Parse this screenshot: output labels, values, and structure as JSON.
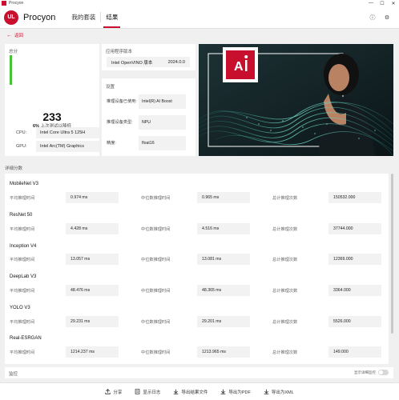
{
  "window": {
    "title": "Procyon",
    "controls": [
      "—",
      "☐",
      "✕"
    ]
  },
  "header": {
    "logo": "UL",
    "brand": "Procyon",
    "nav": [
      {
        "label": "我的套装"
      },
      {
        "label": "结果"
      }
    ],
    "icons": [
      "ⓘ",
      "⚙"
    ]
  },
  "back": {
    "label": "返回"
  },
  "score": {
    "label": "总分",
    "value": "233",
    "delta_value": "6%",
    "delta_text": "上次测试以降低",
    "accent": "#49c239"
  },
  "hardware": {
    "cpu_label": "CPU:",
    "cpu_value": "Intel Core Ultra 5 125H",
    "gpu_label": "GPU:",
    "gpu_value": "Intel Arc(TM) Graphics"
  },
  "version": {
    "label": "应用程序版本",
    "name": "Intel OpenVINO 版本",
    "value": "2024.0.0"
  },
  "settings": {
    "label": "设置",
    "rows": [
      {
        "key": "推理设备已使用:",
        "value": "Intel(R) AI Boost"
      },
      {
        "key": "推理设备类型:",
        "value": "NPU"
      },
      {
        "key": "精度:",
        "value": "float16"
      }
    ]
  },
  "details": {
    "label": "详细分数",
    "col_labels": {
      "avg": "平均推理时间",
      "median": "中位数推理时间",
      "total": "总计推理次数"
    },
    "models": [
      {
        "name": "MobileNet V3",
        "avg": "0.974 ms",
        "median": "0.965 ms",
        "total": "150532.000"
      },
      {
        "name": "ResNet 50",
        "avg": "4.428 ms",
        "median": "4.516 ms",
        "total": "37744.000"
      },
      {
        "name": "Inception V4",
        "avg": "13.057 ms",
        "median": "13.081 ms",
        "total": "12369.000"
      },
      {
        "name": "DeepLab V3",
        "avg": "48.476 ms",
        "median": "48.365 ms",
        "total": "3364.000"
      },
      {
        "name": "YOLO V3",
        "avg": "29.231 ms",
        "median": "29.201 ms",
        "total": "5526.000"
      },
      {
        "name": "Real-ESRGAN",
        "avg": "1214.237 ms",
        "median": "1213.965 ms",
        "total": "149.000"
      }
    ]
  },
  "monitor": {
    "label": "监控",
    "toggle_label": "显示详细监控"
  },
  "footer": {
    "buttons": [
      {
        "label": "分享",
        "icon": "share-icon"
      },
      {
        "label": "显示日志",
        "icon": "log-icon"
      },
      {
        "label": "导出结果文件",
        "icon": "export-file-icon"
      },
      {
        "label": "导出为PDF",
        "icon": "pdf-icon"
      },
      {
        "label": "导出为XML",
        "icon": "xml-icon"
      }
    ]
  },
  "colors": {
    "accent": "#c8102e",
    "score_bar": "#49c239"
  }
}
